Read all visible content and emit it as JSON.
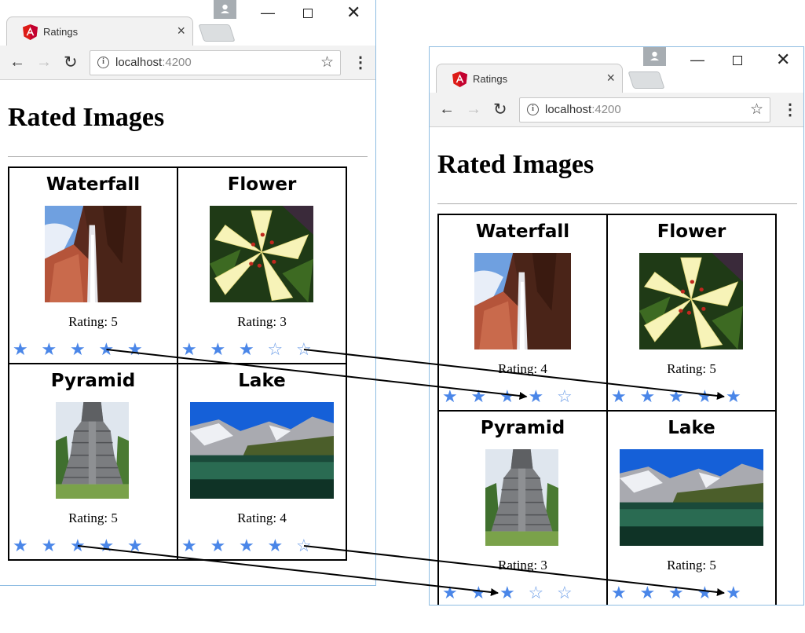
{
  "windows": [
    {
      "id": "left",
      "tab_title": "Ratings",
      "url_host": "localhost",
      "url_port": ":4200",
      "page_title": "Rated Images",
      "images": [
        {
          "title": "Waterfall",
          "rating_label": "Rating: 5",
          "rating": 5
        },
        {
          "title": "Flower",
          "rating_label": "Rating: 3",
          "rating": 3
        },
        {
          "title": "Pyramid",
          "rating_label": "Rating: 5",
          "rating": 5
        },
        {
          "title": "Lake",
          "rating_label": "Rating: 4",
          "rating": 4
        }
      ]
    },
    {
      "id": "right",
      "tab_title": "Ratings",
      "url_host": "localhost",
      "url_port": ":4200",
      "page_title": "Rated Images",
      "images": [
        {
          "title": "Waterfall",
          "rating_label": "Rating: 4",
          "rating": 4
        },
        {
          "title": "Flower",
          "rating_label": "Rating: 5",
          "rating": 5
        },
        {
          "title": "Pyramid",
          "rating_label": "Rating: 3",
          "rating": 3
        },
        {
          "title": "Lake",
          "rating_label": "Rating: 5",
          "rating": 5
        }
      ]
    }
  ],
  "max_stars": 5,
  "icons": {
    "tab_favicon": "angular-logo-icon",
    "tab_close": "close-icon",
    "back": "arrow-left-icon",
    "forward": "arrow-right-icon",
    "reload": "reload-icon",
    "site_info": "info-icon",
    "bookmark": "star-outline-icon",
    "menu": "kebab-menu-icon",
    "star_filled": "star-filled-icon",
    "star_empty": "star-outline-icon"
  },
  "colors": {
    "star": "#4a86e8",
    "window_border": "#8fbde2",
    "angular_red": "#dd1b16",
    "arrow": "#000000"
  }
}
